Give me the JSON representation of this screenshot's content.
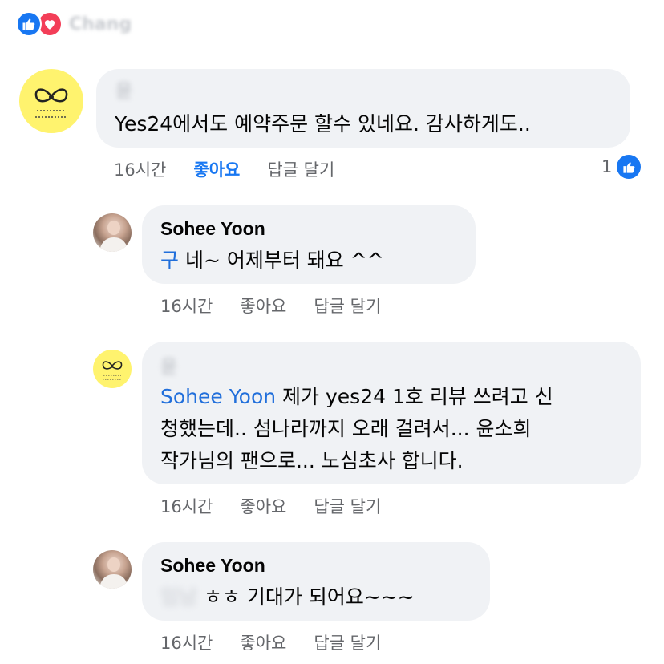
{
  "top": {
    "reactions": [
      "like-icon",
      "love-icon"
    ],
    "name": "Chang"
  },
  "comments": [
    {
      "author": "윤",
      "author_blurred": true,
      "mention": "",
      "text": "Yes24에서도 예약주문 할수 있네요. 감사하게도..",
      "time": "16시간",
      "like_label": "좋아요",
      "reply_label": "답글 달기",
      "liked": true,
      "reaction_count": "1",
      "avatar": "yellow-bow-avatar"
    },
    {
      "author": "Sohee Yoon",
      "mention": "구",
      "text": " 네~ 어제부터 돼요 ^^",
      "time": "16시간",
      "like_label": "좋아요",
      "reply_label": "답글 달기",
      "avatar": "profile-photo-avatar"
    },
    {
      "author": "윤",
      "author_blurred": true,
      "mention": "Sohee Yoon",
      "lines": [
        " 제가 yes24 1호 리뷰 쓰려고 신",
        "청했는데.. 섬나라까지 오래 걸려서... 윤소희",
        "작가님의 팬으로... 노심초사 합니다."
      ],
      "time": "16시간",
      "like_label": "좋아요",
      "reply_label": "답글 달기",
      "avatar": "yellow-bow-avatar"
    },
    {
      "author": "Sohee Yoon",
      "mention": "임남",
      "text": " ㅎㅎ 기대가 되어요~~~",
      "time": "16시간",
      "like_label": "좋아요",
      "reply_label": "답글 달기",
      "avatar": "profile-photo-avatar"
    }
  ],
  "colors": {
    "accent": "#1877f2",
    "mention": "#216fdb",
    "bubble": "#f0f2f5",
    "meta": "#65676b",
    "avatar_yellow": "#fff36e"
  }
}
